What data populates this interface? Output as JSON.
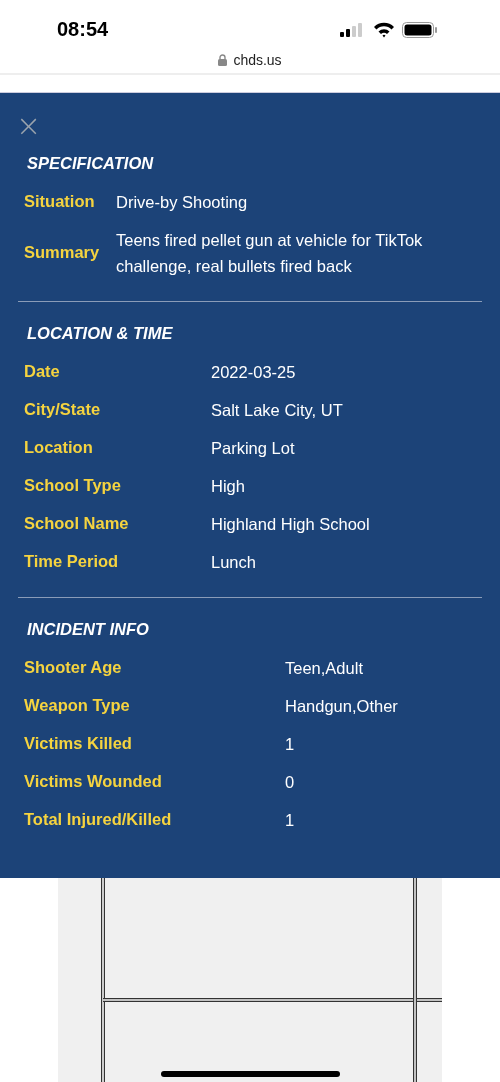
{
  "status_bar": {
    "time": "08:54"
  },
  "browser": {
    "url": "chds.us"
  },
  "panel": {
    "close": "×",
    "sections": [
      {
        "title": "SPECIFICATION",
        "rows": [
          {
            "label": "Situation",
            "value": "Drive-by Shooting"
          },
          {
            "label": "Summary",
            "value": "Teens fired pellet gun at vehicle for TikTok challenge, real bullets fired back"
          }
        ]
      },
      {
        "title": "LOCATION & TIME",
        "rows": [
          {
            "label": "Date",
            "value": "2022-03-25"
          },
          {
            "label": "City/State",
            "value": "Salt Lake City, UT"
          },
          {
            "label": "Location",
            "value": "Parking Lot"
          },
          {
            "label": "School Type",
            "value": "High"
          },
          {
            "label": "School Name",
            "value": "Highland High School"
          },
          {
            "label": "Time Period",
            "value": "Lunch"
          }
        ]
      },
      {
        "title": "INCIDENT INFO",
        "rows": [
          {
            "label": "Shooter Age",
            "value": "Teen,Adult"
          },
          {
            "label": "Weapon Type",
            "value": "Handgun,Other"
          },
          {
            "label": "Victims Killed",
            "value": "1"
          },
          {
            "label": "Victims Wounded",
            "value": "0"
          },
          {
            "label": "Total Injured/Killed",
            "value": "1"
          }
        ]
      }
    ]
  }
}
